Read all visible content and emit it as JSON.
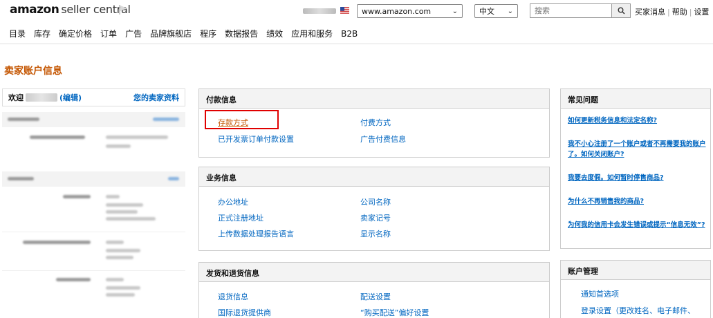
{
  "header": {
    "logo_brand": "amazon",
    "logo_product": "seller central",
    "site_select": "www.amazon.com",
    "lang_select": "中文",
    "search_placeholder": "搜索",
    "top_links": [
      "买家消息",
      "帮助",
      "设置"
    ]
  },
  "nav": [
    "目录",
    "库存",
    "确定价格",
    "订单",
    "广告",
    "品牌旗舰店",
    "程序",
    "数据报告",
    "绩效",
    "应用和服务",
    "B2B"
  ],
  "page_title": "卖家账户信息",
  "left": {
    "welcome": "欢迎",
    "edit": "(编辑)",
    "profile": "您的卖家资料"
  },
  "payment": {
    "title": "付款信息",
    "links": [
      "存款方式",
      "付费方式",
      "已开发票订单付款设置",
      "广告付费信息"
    ]
  },
  "business": {
    "title": "业务信息",
    "links": [
      "办公地址",
      "公司名称",
      "正式注册地址",
      "卖家记号",
      "上传数据处理报告语言",
      "显示名称"
    ]
  },
  "shipping": {
    "title": "发货和退货信息",
    "links": [
      "退货信息",
      "配送设置",
      "国际退货提供商",
      "“购买配送”偏好设置"
    ]
  },
  "faq": {
    "title": "常见问题",
    "items": [
      "如何更新税务信息和法定名称?",
      "我不小心注册了一个账户或者不再需要我的账户了。如何关闭账户?",
      "我要去度假。如何暂时停售商品?",
      "为什么不再销售我的商品?",
      "为何我的信用卡会发生错误或提示“信息无效”?"
    ]
  },
  "account": {
    "title": "账户管理",
    "links": [
      "通知首选项",
      "登录设置（更改姓名、电子邮件、"
    ]
  },
  "colors": {
    "link": "#0066c0",
    "title": "#c45500",
    "highlight": "#e00000"
  }
}
